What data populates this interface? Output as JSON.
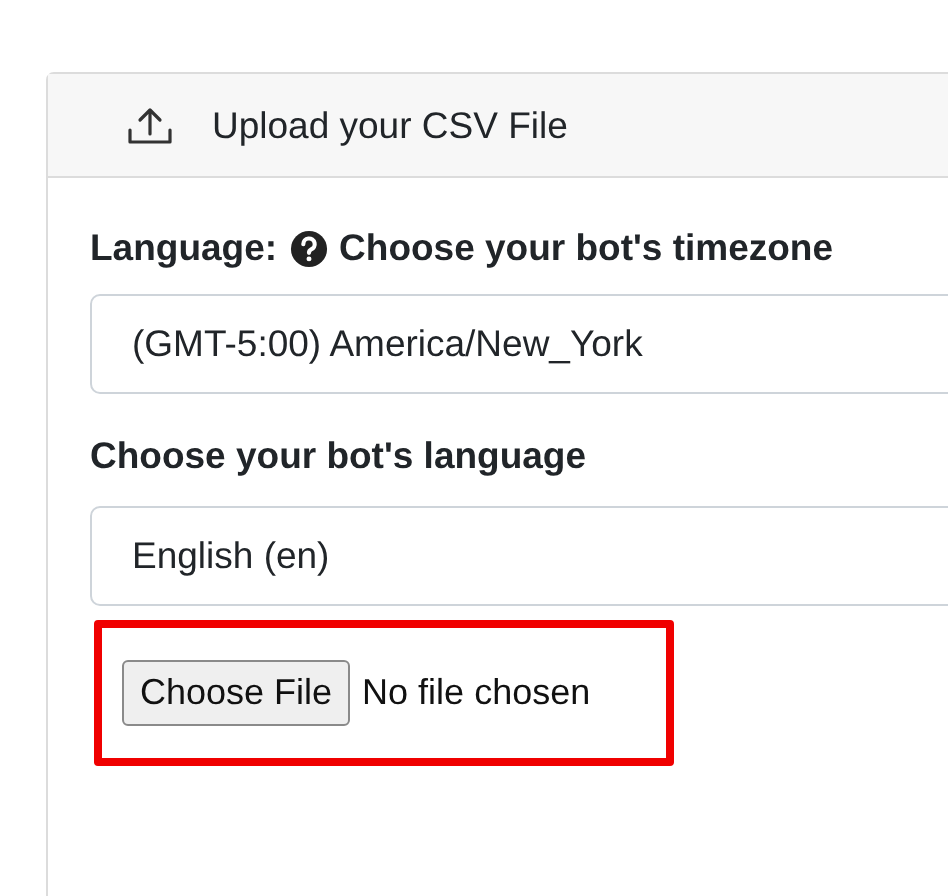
{
  "card_header": {
    "title": "Upload your CSV File"
  },
  "timezone_label": {
    "prefix": "Language:",
    "text": "Choose your bot's timezone"
  },
  "timezone_select": {
    "value": "(GMT-5:00) America/New_York"
  },
  "language_label": "Choose your bot's language",
  "language_select": {
    "value": "English (en)"
  },
  "file_input": {
    "button": "Choose File",
    "status": "No file chosen"
  }
}
